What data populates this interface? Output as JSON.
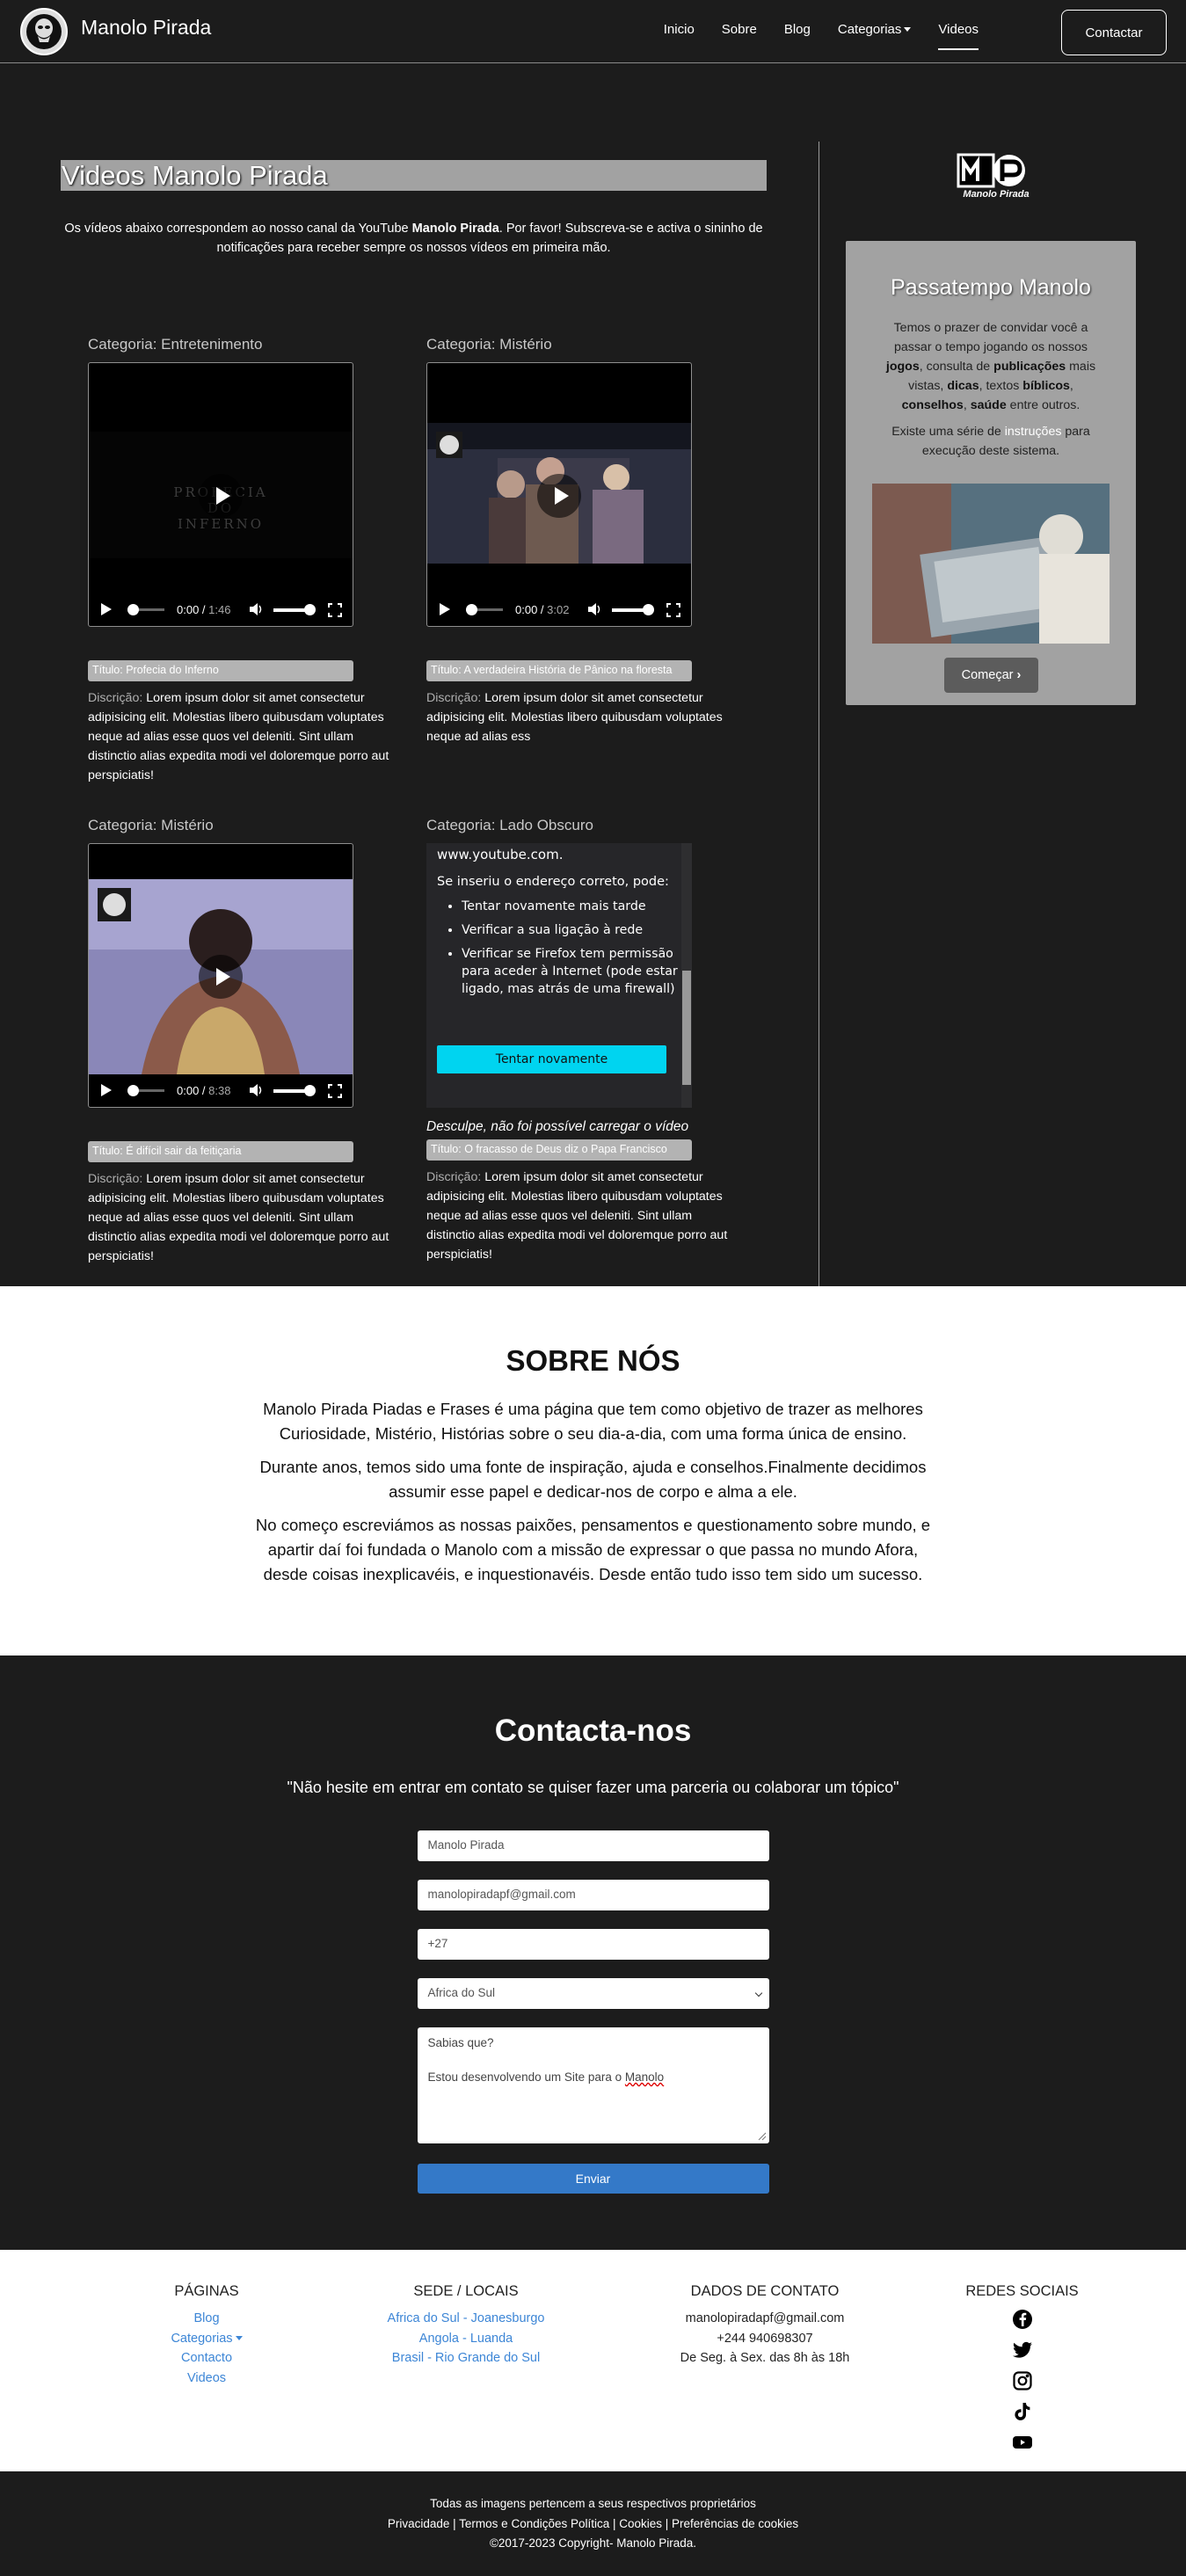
{
  "nav": {
    "brand": "Manolo Pirada",
    "links": [
      "Inicio",
      "Sobre",
      "Blog",
      "Categorias",
      "Videos"
    ],
    "contact": "Contactar"
  },
  "videos": {
    "title": "Videos Manolo Pirada",
    "intro_pre": "Os vídeos abaixo correspondem ao nosso canal da YouTube ",
    "intro_bold": "Manolo Pirada",
    "intro_post": ". Por favor! Subscreva-se e activa o sininho de notificações para receber sempre os nossos vídeos em primeira mão.",
    "desc_label": "Discrição:",
    "cards": [
      {
        "category": "Categoria: Entretenimento",
        "current": "0:00",
        "duration": "1:46",
        "overlay": "PROFECIA DO INFERNO",
        "title": "Título: Profecia do Inferno",
        "desc": "Lorem ipsum dolor sit amet consectetur adipisicing elit. Molestias libero quibusdam voluptates neque ad alias esse quos vel deleniti. Sint ullam distinctio alias expedita modi vel doloremque porro aut perspiciatis!"
      },
      {
        "category": "Categoria: Mistério",
        "current": "0:00",
        "duration": "3:02",
        "title": "Título: A verdadeira História de Pânico na floresta",
        "desc": "Lorem ipsum dolor sit amet consectetur adipisicing elit. Molestias libero quibusdam voluptates neque ad alias ess"
      },
      {
        "category": "Categoria: Mistério",
        "current": "0:00",
        "duration": "8:38",
        "title": "Título: É difícil sair da feitiçaria",
        "desc": "Lorem ipsum dolor sit amet consectetur adipisicing elit. Molestias libero quibusdam voluptates neque ad alias esse quos vel deleniti. Sint ullam distinctio alias expedita modi vel doloremque porro aut perspiciatis!"
      },
      {
        "category": "Categoria: Lado Obscuro",
        "title": "Título: O fracasso de Deus diz o Papa Francisco",
        "desc": "Lorem ipsum dolor sit amet consectetur adipisicing elit. Molestias libero quibusdam voluptates neque ad alias esse quos vel deleniti. Sint ullam distinctio alias expedita modi vel doloremque porro aut perspiciatis!"
      }
    ],
    "error": {
      "host": "www.youtube.com.",
      "heading": "Se inseriu o endereço correto, pode:",
      "items": [
        "Tentar novamente mais tarde",
        "Verificar a sua ligação à rede",
        "Verificar se Firefox tem permissão para aceder à Internet (pode estar ligado, mas atrás de uma firewall)"
      ],
      "retry": "Tentar novamente",
      "caption": "Desculpe, não foi possível carregar o vídeo"
    }
  },
  "logo_text": "Manolo Pirada",
  "side": {
    "title": "Passatempo Manolo",
    "p1_a": "Temos o prazer de convidar você a passar o tempo jogando os nossos ",
    "p1_jogos": "jogos",
    "p1_b": ", consulta de ",
    "p1_pub": "publicações",
    "p1_c": " mais vistas, ",
    "p1_dicas": "dicas",
    "p1_d": ", textos ",
    "p1_bib": "bíblicos",
    "p1_e": ", ",
    "p1_cons": "conselhos",
    "p1_f": ", ",
    "p1_saude": "saúde",
    "p1_g": " entre outros.",
    "p2_a": "Existe uma série de ",
    "p2_link": "instruções",
    "p2_b": " para execução deste sistema.",
    "button": "Começar"
  },
  "sobre": {
    "title": "SOBRE NÓS",
    "p1": "Manolo Pirada Piadas e Frases é uma página que tem como objetivo de trazer as melhores Curiosidade, Mistério, Histórias sobre o seu dia-a-dia, com uma forma única de ensino.",
    "p2": "Durante anos, temos sido uma fonte de inspiração, ajuda e conselhos.Finalmente decidimos assumir esse papel e dedicar-nos de corpo e alma a ele.",
    "p3": "No começo escreviámos as nossas paixões, pensamentos e questionamento sobre mundo, e apartir daí foi fundada o Manolo com a missão de expressar o que passa no mundo Afora, desde coisas inexplicavéis, e inquestionavéis. Desde então tudo isso tem sido um sucesso."
  },
  "contact": {
    "title": "Contacta-nos",
    "quote": "\"Não hesite em entrar em contato se quiser fazer uma parceria ou colaborar um tópico\"",
    "name": "Manolo Pirada",
    "email": "manolopiradapf@gmail.com",
    "phone": "+27",
    "country": "Africa do Sul",
    "msg_line1": "Sabias que?",
    "msg_line2_a": "Estou desenvolvendo um Site para o ",
    "msg_line2_b": "Manolo",
    "send": "Enviar"
  },
  "footer": {
    "pages_title": "PÁGINAS",
    "pages": [
      "Blog",
      "Categorias",
      "Contacto",
      "Videos"
    ],
    "sede_title": "SEDE / LOCAIS",
    "sede": [
      "Africa do Sul - Joanesburgo",
      "Angola - Luanda",
      "Brasil - Rio Grande do Sul"
    ],
    "dados_title": "DADOS DE CONTATO",
    "dados": [
      "manolopiradapf@gmail.com",
      "+244 940698307",
      "De Seg. à Sex. das 8h às 18h"
    ],
    "redes_title": "REDES SOCIAIS",
    "bottom1": "Todas as imagens pertencem a seus respectivos proprietários",
    "bottom2": "Privacidade | Termos e Condições Política | Cookies | Preferências de cookies",
    "bottom3": "©2017-2023 Copyright- Manolo Pirada."
  },
  "colors": {
    "bg": "#1c1c1c",
    "panel": "#a2a2a2",
    "accent": "#3479c8",
    "retry": "#00d4f0",
    "link": "#3d86d6"
  }
}
